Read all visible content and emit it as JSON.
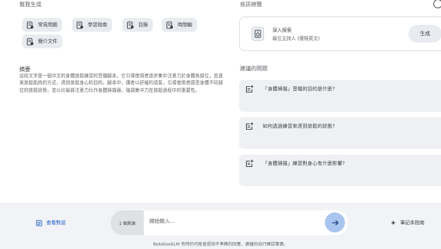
{
  "help": {
    "title": "幫我生成",
    "chips": [
      {
        "label": "常見問題",
        "icon": "note-icon"
      },
      {
        "label": "學習指南",
        "icon": "note-icon"
      },
      {
        "label": "目錄",
        "icon": "note-icon"
      },
      {
        "label": "時間軸",
        "icon": "note-icon"
      },
      {
        "label": "簡介文件",
        "icon": "note-icon"
      }
    ]
  },
  "summary": {
    "title": "摘要",
    "text": "這段文字是一個中文的身體放鬆練習的音檔腳本，它引導使用者逐步集中注意力於身體各部位，並逐漸放鬆肌肉的方式，達到放鬆身心的目的。腳本中，講者以舒緩的語氣，引導使用者感受身體不同部位的放鬆狀態，並以比喻將注意力比作身體掃描器，強調集中力在放鬆過程中的重要性。"
  },
  "audio": {
    "title": "音訊總覽",
    "card_title": "深入探索",
    "card_subtitle": "兩位主持人 (僅限英文)",
    "generate_label": "生成"
  },
  "suggested": {
    "title": "建議的問題",
    "questions": [
      "「身體掃描」音檔的目的是什麼?",
      "如何透過練習來達到放鬆的狀態?",
      "「身體掃描」練習對身心有什麼影響?"
    ]
  },
  "bottom": {
    "view_chat_label": "查看對話",
    "source_count": "1 個來源",
    "input_placeholder": "開始輸入...",
    "guide_label": "筆記本指南",
    "disclaimer": "NotebookLM 有時仍可能會提供不準確的回應，建議你自行確認事實。"
  },
  "colors": {
    "accent": "#1a56c4",
    "send_button": "#a8c4ef",
    "chip_bg": "#e8ebf0",
    "bottom_bar": "#f1f3f6"
  }
}
